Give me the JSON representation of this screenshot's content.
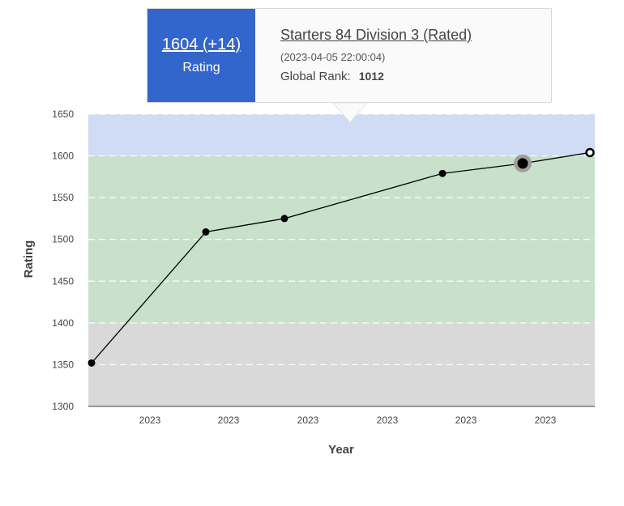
{
  "tooltip": {
    "rating_text": "1604 (+14)",
    "rating_label": "Rating",
    "contest_name": "Starters 84 Division 3 (Rated)",
    "contest_date": "(2023-04-05 22:00:04)",
    "rank_label": "Global Rank:",
    "rank_value": "1012"
  },
  "colors": {
    "tooltip_accent": "#3366cc",
    "band_top": "#d0dcf4",
    "band_middle": "#c9e1cb",
    "band_bottom": "#d9d9d9",
    "line": "#000000",
    "point": "#000000",
    "highlight_ring": "#9e9e9e"
  },
  "chart_data": {
    "type": "line",
    "xlabel": "Year",
    "ylabel": "Rating",
    "ylim": [
      1300,
      1650
    ],
    "yticks": [
      1300,
      1350,
      1400,
      1450,
      1500,
      1550,
      1600,
      1650
    ],
    "xticks": [
      "2023",
      "2023",
      "2023",
      "2023",
      "2023",
      "2023"
    ],
    "grid": true,
    "bands": [
      {
        "from": 1300,
        "to": 1400
      },
      {
        "from": 1400,
        "to": 1600
      },
      {
        "from": 1600,
        "to": 1650
      }
    ],
    "series": [
      {
        "values": [
          1352,
          1509,
          1525,
          1579,
          1591,
          1604
        ],
        "highlighted_index": 4,
        "latest_index": 5
      }
    ]
  }
}
